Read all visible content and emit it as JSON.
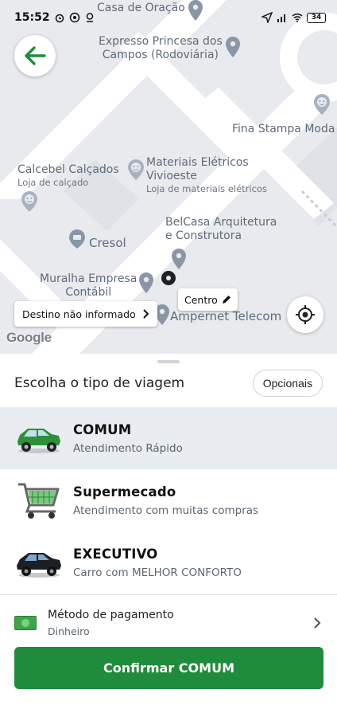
{
  "status_bar": {
    "time": "15:52",
    "battery": "34"
  },
  "map": {
    "pois": [
      {
        "id": "casa-oracao",
        "name": "Casa de Oração"
      },
      {
        "id": "expresso",
        "name": "Expresso Princesa dos\nCampos (Rodoviária)"
      },
      {
        "id": "fina-stampa",
        "name": "Fina Stampa Moda"
      },
      {
        "id": "calcebel",
        "name": "Calcebel Calçados",
        "sub": "Loja de calçado"
      },
      {
        "id": "materiais",
        "name": "Materiais Elétricos\nVivioeste",
        "sub": "Loja de materiais elétricos"
      },
      {
        "id": "belcasa",
        "name": "BelCasa Arquitetura\ne Construtora"
      },
      {
        "id": "cresol",
        "name": "Cresol"
      },
      {
        "id": "muralha",
        "name": "Muralha Empresa\nContábil"
      },
      {
        "id": "ampernet",
        "name": "Ampernet Telecom"
      }
    ],
    "destination_label": "Destino não informado",
    "origin_label": "Centro",
    "attribution": "Google"
  },
  "sheet": {
    "title": "Escolha o tipo de viagem",
    "optional_button": "Opcionais",
    "trip_types": [
      {
        "name": "COMUM",
        "description": "Atendimento Rápido",
        "icon": "green-car-icon",
        "selected": true
      },
      {
        "name": "Supermecado",
        "description": "Atendimento com muitas compras",
        "icon": "shopping-cart-icon",
        "selected": false
      },
      {
        "name": "EXECUTIVO",
        "description": "Carro com MELHOR CONFORTO",
        "icon": "black-car-icon",
        "selected": false
      }
    ],
    "payment": {
      "label": "Método de pagamento",
      "value": "Dinheiro",
      "icon": "cash-icon"
    },
    "confirm_button": "Confirmar COMUM"
  },
  "colors": {
    "primary_green": "#1f8c3c",
    "back_arrow_green": "#1f8c3c",
    "selected_row": "#e9ecf0",
    "map_background": "#e8eaed",
    "map_road": "#ffffff"
  }
}
